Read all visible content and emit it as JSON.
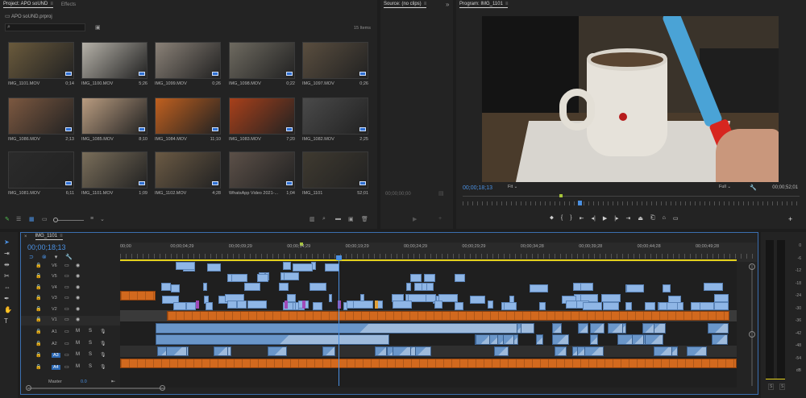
{
  "colors": {
    "accent": "#4a90e2",
    "video_clip": "#8fb6e6",
    "audio_clip": "#6a96c9",
    "orange_clip": "#d2691e",
    "purple_clip": "#a04ab7",
    "yellow_line": "#e5d21c"
  },
  "project": {
    "tab_label": "Project: APO soUND",
    "effects_tab": "Effects",
    "file_name": "APO soUND.prproj",
    "items_count": "15 Items",
    "items": [
      {
        "name": "IMG_1101.MOV",
        "duration": "0;14",
        "color": "#6a5a3c"
      },
      {
        "name": "IMG_1100.MOV",
        "duration": "5;26",
        "color": "#b5b1a8"
      },
      {
        "name": "IMG_1099.MOV",
        "duration": "0;26",
        "color": "#8a8177"
      },
      {
        "name": "IMG_1098.MOV",
        "duration": "0;22",
        "color": "#6e6a60"
      },
      {
        "name": "IMG_1097.MOV",
        "duration": "0;26",
        "color": "#5a4e3f"
      },
      {
        "name": "IMG_1086.MOV",
        "duration": "2;13",
        "color": "#7c5840"
      },
      {
        "name": "IMG_1085.MOV",
        "duration": "8;10",
        "color": "#b99c80"
      },
      {
        "name": "IMG_1084.MOV",
        "duration": "11;10",
        "color": "#c0601f"
      },
      {
        "name": "IMG_1083.MOV",
        "duration": "7;20",
        "color": "#a8401a"
      },
      {
        "name": "IMG_1082.MOV",
        "duration": "2;25",
        "color": "#4a4a4a"
      },
      {
        "name": "IMG_1081.MOV",
        "duration": "6;11",
        "color": "#2b2b2b"
      },
      {
        "name": "IMG_1101.MOV",
        "duration": "1;09",
        "color": "#7a6e5a"
      },
      {
        "name": "IMG_1102.MOV",
        "duration": "4;28",
        "color": "#6b5a44"
      },
      {
        "name": "WhatsApp Video 2021-...",
        "duration": "1;04",
        "color": "#5c5048"
      },
      {
        "name": "IMG_1101",
        "duration": "52;01",
        "color": "#3f3a30"
      }
    ]
  },
  "source": {
    "tab_label": "Source: (no clips)",
    "timecode": "00;00;00;00"
  },
  "program": {
    "tab_label": "Program: IMG_1101",
    "timecode": "00;00;18;13",
    "fit": "Fit",
    "quality": "Full",
    "duration": "00;00;52;01"
  },
  "timeline": {
    "tab_label": "IMG_1101",
    "timecode": "00;00;18;13",
    "ruler": [
      "00;00",
      "00;00;04;29",
      "00;00;09;29",
      "00;00;14;29",
      "00;00;19;29",
      "00;00;24;29",
      "00;00;29;29",
      "00;00;34;28",
      "00;00;39;28",
      "00;00;44;28",
      "00;00;49;28"
    ],
    "video_tracks": [
      "V6",
      "V5",
      "V4",
      "V3",
      "V2",
      "V1"
    ],
    "audio_tracks": [
      "A1",
      "A2",
      "A3",
      "A4"
    ],
    "master_label": "Master",
    "master_value": "0.0"
  },
  "meter": {
    "labels": [
      "0",
      "-6",
      "-12",
      "-18",
      "-24",
      "-30",
      "-36",
      "-42",
      "-48",
      "-54",
      "dB"
    ],
    "bottom": [
      "S",
      "S"
    ]
  }
}
